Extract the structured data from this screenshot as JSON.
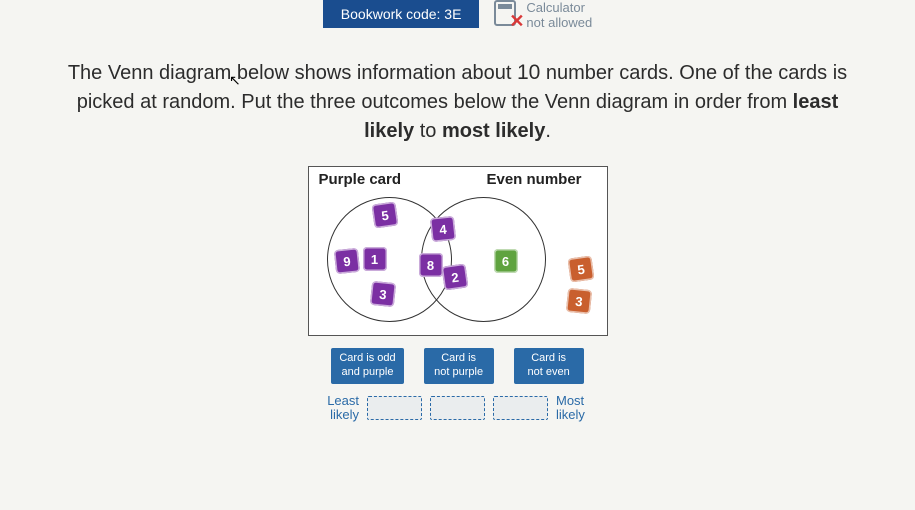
{
  "header": {
    "bookwork_label": "Bookwork code: 3E",
    "calculator_line1": "Calculator",
    "calculator_line2": "not allowed"
  },
  "question": {
    "part1": "The Venn diagram below shows information about ",
    "count": "10",
    "part2": " number cards. One of the cards is picked at random. Put the three outcomes below the Venn diagram in order from ",
    "strong1": "least likely",
    "mid": " to ",
    "strong2": "most likely",
    "end": "."
  },
  "venn": {
    "left_label": "Purple card",
    "right_label": "Even number",
    "cards": {
      "p5": "5",
      "p9": "9",
      "p1": "1",
      "p3": "3",
      "p4": "4",
      "p8": "8",
      "p2": "2",
      "g6": "6",
      "o5": "5",
      "o3": "3"
    }
  },
  "outcomes": {
    "o1_l1": "Card is odd",
    "o1_l2": "and purple",
    "o2_l1": "Card is",
    "o2_l2": "not purple",
    "o3_l1": "Card is",
    "o3_l2": "not even"
  },
  "ordering": {
    "least": "Least likely",
    "most": "Most likely"
  }
}
